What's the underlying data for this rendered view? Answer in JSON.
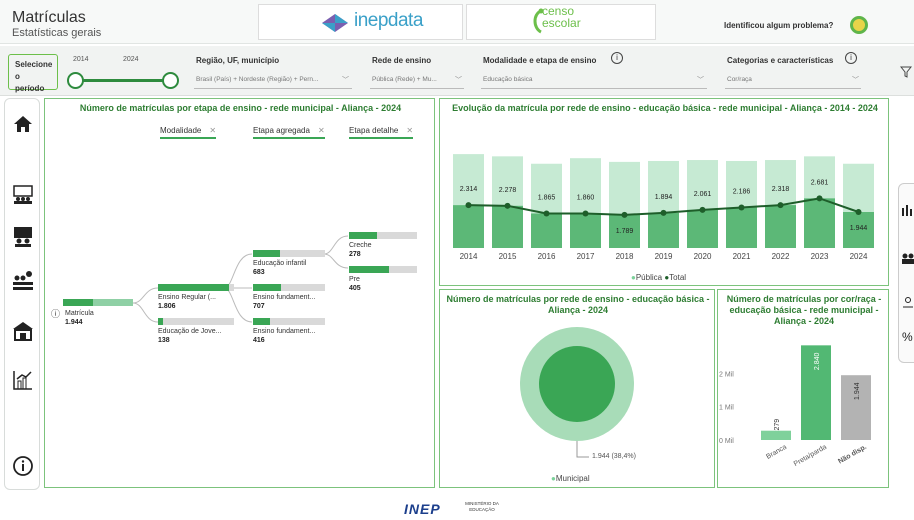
{
  "header": {
    "title": "Matrículas",
    "subtitle": "Estatísticas gerais",
    "logo_inep": "inepdata",
    "logo_censo": "censo escolar",
    "problem_label": "Identificou algum problema?",
    "problem_icon": "help-face-icon"
  },
  "filters": {
    "period_label": "Selecione o período",
    "period_start": "2014",
    "period_end": "2024",
    "regiao": {
      "label": "Região, UF, município",
      "value": "Brasil (País) + Nordeste (Região) + Pern..."
    },
    "rede": {
      "label": "Rede de ensino",
      "value": "Pública (Rede) + Mu..."
    },
    "modalidade": {
      "label": "Modalidade e etapa de ensino",
      "value": "Educação básica"
    },
    "categorias": {
      "label": "Categorias e características",
      "value": "Cor/raça"
    },
    "filter_icon": "funnel-icon"
  },
  "sidebar": {
    "icons": [
      "home-icon",
      "students-icon",
      "teacher-icon",
      "staff-icon",
      "school-icon",
      "indicator-chart-icon",
      "info-icon"
    ]
  },
  "rightrail": {
    "icons": [
      "bar-chart-icon",
      "people-icon",
      "person-icon",
      "percent-icon"
    ],
    "percent": "%"
  },
  "tree": {
    "title": "Número de matrículas por etapa de ensino - rede municipal - Aliança - 2024",
    "chips": [
      "Modalidade",
      "Etapa agregada",
      "Etapa detalhe"
    ],
    "info": "ⓘ",
    "root": {
      "label": "Matrícula",
      "value": "1.944"
    },
    "level1": [
      {
        "label": "Ensino Regular (...",
        "value": "1.806",
        "fill": 0.93
      },
      {
        "label": "Educação de Jove...",
        "value": "138",
        "fill": 0.07
      }
    ],
    "level2": [
      {
        "label": "Educação infantil",
        "value": "683",
        "fill": 0.38
      },
      {
        "label": "Ensino fundament...",
        "value": "707",
        "fill": 0.39
      },
      {
        "label": "Ensino fundament...",
        "value": "416",
        "fill": 0.23
      }
    ],
    "level3": [
      {
        "label": "Creche",
        "value": "278",
        "fill": 0.41
      },
      {
        "label": "Pre",
        "value": "405",
        "fill": 0.59
      }
    ]
  },
  "evolution": {
    "title": "Evolução da matrícula por rede de ensino - educação básica - rede municipal - Aliança - 2014 - 2024",
    "legend": [
      "Pública",
      "Total"
    ]
  },
  "donut": {
    "title": "Número de matrículas por rede de ensino - educação básica - Aliança - 2024",
    "label": "1.944 (38,4%)",
    "legend": "Municipal"
  },
  "race": {
    "title": "Número de matrículas por cor/raça - educação básica - rede municipal - Aliança - 2024",
    "yticks": [
      "2 Mil",
      "1 Mil",
      "0 Mil"
    ]
  },
  "footer": {
    "brand": "INEP",
    "ministry": "MINISTÉRIO DA EDUCAÇÃO"
  },
  "colors": {
    "accent": "#2e7d32",
    "light_bar": "#b5e3c6",
    "mid_bar": "#3aa655",
    "dark_line": "#1e5e2a"
  },
  "chart_data": [
    {
      "type": "bar",
      "title": "Evolução da matrícula por rede de ensino - educação básica - rede municipal - Aliança - 2014 - 2024",
      "categories": [
        "2014",
        "2015",
        "2016",
        "2017",
        "2018",
        "2019",
        "2020",
        "2021",
        "2022",
        "2023",
        "2024"
      ],
      "series": [
        {
          "name": "Pública",
          "values": [
            5070,
            4950,
            4550,
            4850,
            4650,
            4700,
            4750,
            4700,
            4750,
            4950,
            4550
          ]
        },
        {
          "name": "Total",
          "values": [
            2314,
            2278,
            1865,
            1860,
            1789,
            1894,
            2061,
            2186,
            2318,
            2681,
            1944
          ]
        }
      ],
      "data_labels": [
        "2.314",
        "2.278",
        "1.865",
        "1.860",
        "1.789",
        "1.894",
        "2.061",
        "2.186",
        "2.318",
        "2.681",
        "1.944"
      ]
    },
    {
      "type": "pie",
      "title": "Número de matrículas por rede de ensino - educação básica - Aliança - 2024",
      "values": [
        1944
      ],
      "labels": [
        "Municipal"
      ],
      "share": 38.4
    },
    {
      "type": "bar",
      "title": "Número de matrículas por cor/raça - educação básica - rede municipal - Aliança - 2024",
      "categories": [
        "Branca",
        "Preta/parda",
        "Não disp."
      ],
      "values": [
        279,
        2840,
        1944
      ],
      "data_labels": [
        "279",
        "2.840",
        "1.944"
      ],
      "ylim": [
        0,
        3000
      ],
      "yticks": [
        "0 Mil",
        "1 Mil",
        "2 Mil"
      ]
    }
  ]
}
